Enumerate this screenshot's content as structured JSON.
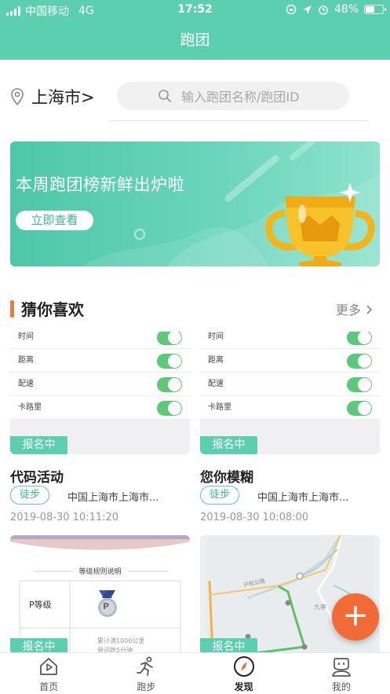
{
  "status_bar": {
    "carrier": "中国移动",
    "network": "4G",
    "time": "17:52",
    "battery": "48%",
    "battery_level": 0.48
  },
  "nav": {
    "title": "跑团"
  },
  "location": {
    "city": "上海市>"
  },
  "search": {
    "placeholder": "输入跑团名称/跑团ID"
  },
  "banner": {
    "title": "本周跑团榜新鲜出炉啦",
    "cta": "立即查看"
  },
  "section": {
    "title": "猜你喜欢",
    "more": "更多"
  },
  "cards": [
    {
      "rows": [
        "时间",
        "距离",
        "配速",
        "卡路里"
      ],
      "badge": "报名中",
      "name": "代码活动",
      "tag": "徒步",
      "address": "中国上海市上海市...",
      "date": "2019-08-30 10:11:20"
    },
    {
      "rows": [
        "时间",
        "距离",
        "配速",
        "卡路里"
      ],
      "badge": "报名中",
      "name": "您你模糊",
      "tag": "徒步",
      "address": "中国上海市上海市...",
      "date": "2019-08-30 10:08:00"
    }
  ],
  "cards_row2": [
    {
      "badge": "报名中",
      "header": "等级规则说明",
      "level": "P等级",
      "medal_letter": "P",
      "rule_1": "累计满1000公里",
      "rule_2": "单词跑5分钟"
    },
    {
      "badge": "报名中",
      "map_label_1": "沪松公路",
      "map_label_2": "九亭"
    }
  ],
  "fab": {
    "label": "+"
  },
  "tabs": [
    {
      "label": "首页",
      "icon": "home-icon"
    },
    {
      "label": "跑步",
      "icon": "runner-icon"
    },
    {
      "label": "发现",
      "icon": "compass-icon"
    },
    {
      "label": "我的",
      "icon": "profile-icon"
    }
  ],
  "colors": {
    "brand": "#5ccfb0",
    "accent": "#f26a35",
    "toggle_on": "#5cc879"
  }
}
